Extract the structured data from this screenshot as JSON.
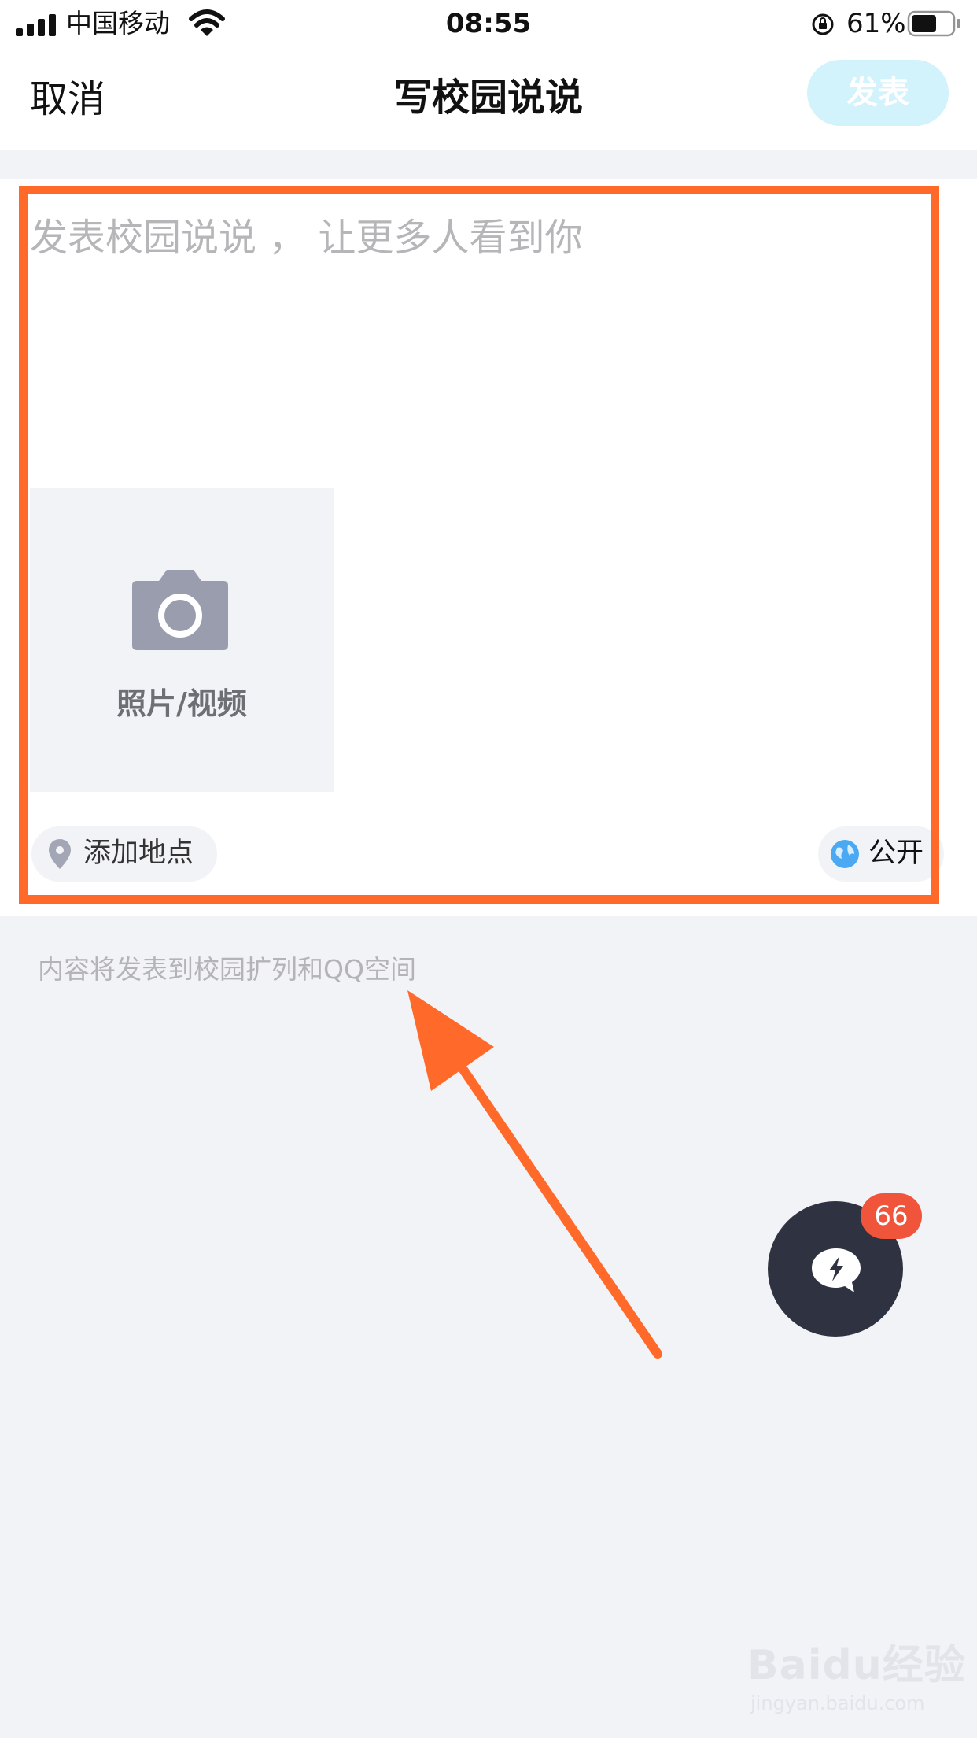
{
  "status_bar": {
    "carrier": "中国移动",
    "time": "08:55",
    "battery_percent": "61%",
    "battery_level": 0.61
  },
  "nav": {
    "cancel_label": "取消",
    "title": "写校园说说",
    "publish_label": "发表"
  },
  "composer": {
    "placeholder": "发表校园说说 ， 让更多人看到你",
    "value": "",
    "media_label": "照片/视频",
    "location_label": "添加地点",
    "privacy_label": "公开"
  },
  "notice": "内容将发表到校园扩列和QQ空间",
  "fab": {
    "badge_count": "66"
  },
  "watermark": {
    "brand": "Baidu经验",
    "url": "jingyan.baidu.com"
  },
  "colors": {
    "annotation": "#ff6a2b",
    "publish_disabled": "#d2f2fc",
    "badge": "#f0553b",
    "fab": "#2f3240"
  },
  "icons": [
    "signal-icon",
    "wifi-icon",
    "rotation-lock-icon",
    "battery-icon",
    "camera-icon",
    "location-pin-icon",
    "globe-icon",
    "lightning-chat-icon"
  ]
}
